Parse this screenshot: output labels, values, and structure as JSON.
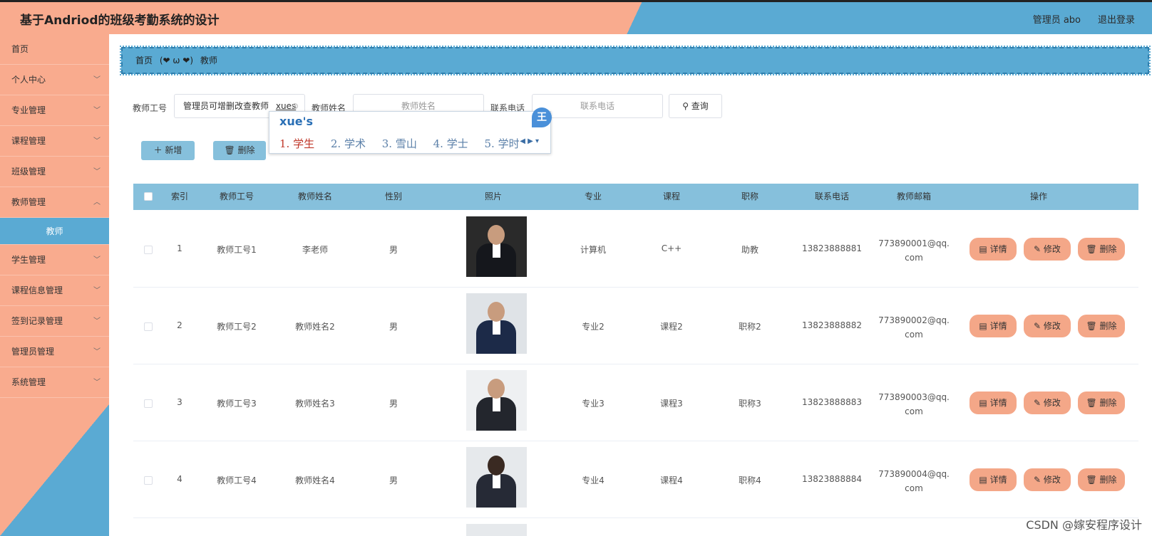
{
  "app": {
    "title": "基于Andriod的班级考勤系统的设计",
    "user": "管理员 abo",
    "logout": "退出登录"
  },
  "sidebar": {
    "items": [
      {
        "label": "首页",
        "arrow": false
      },
      {
        "label": "个人中心",
        "arrow": true
      },
      {
        "label": "专业管理",
        "arrow": true
      },
      {
        "label": "课程管理",
        "arrow": true
      },
      {
        "label": "班级管理",
        "arrow": true
      },
      {
        "label": "教师管理",
        "arrow": true
      },
      {
        "label": "教师",
        "arrow": false,
        "sub": true
      },
      {
        "label": "学生管理",
        "arrow": true
      },
      {
        "label": "课程信息管理",
        "arrow": true
      },
      {
        "label": "签到记录管理",
        "arrow": true
      },
      {
        "label": "管理员管理",
        "arrow": true
      },
      {
        "label": "系统管理",
        "arrow": true
      }
    ]
  },
  "breadcrumb": {
    "home": "首页",
    "sep": "(❤ ω ❤)",
    "current": "教师"
  },
  "search": {
    "id_label": "教师工号",
    "id_value": "管理员可增删改查教师",
    "id_ime": "xues",
    "name_label": "教师姓名",
    "name_placeholder": "教师姓名",
    "phone_label": "联系电话",
    "phone_placeholder": "联系电话",
    "query": "查询"
  },
  "ime": {
    "composition": "xue's",
    "candidates": [
      "1. 学生",
      "2. 学术",
      "3. 雪山",
      "4. 学士",
      "5. 学时"
    ],
    "badge": "王"
  },
  "actions": {
    "add": "新增",
    "delete": "删除"
  },
  "table": {
    "headers": [
      "索引",
      "教师工号",
      "教师姓名",
      "性别",
      "照片",
      "专业",
      "课程",
      "职称",
      "联系电话",
      "教师邮箱",
      "操作"
    ],
    "rows": [
      {
        "index": "1",
        "id": "教师工号1",
        "name": "李老师",
        "gender": "男",
        "major": "计算机",
        "course": "C++",
        "title": "助教",
        "phone": "13823888881",
        "email": "773890001@qq.com",
        "email_l1": "773890001@qq.",
        "email_l2": "com"
      },
      {
        "index": "2",
        "id": "教师工号2",
        "name": "教师姓名2",
        "gender": "男",
        "major": "专业2",
        "course": "课程2",
        "title": "职称2",
        "phone": "13823888882",
        "email": "773890002@qq.com",
        "email_l1": "773890002@qq.",
        "email_l2": "com"
      },
      {
        "index": "3",
        "id": "教师工号3",
        "name": "教师姓名3",
        "gender": "男",
        "major": "专业3",
        "course": "课程3",
        "title": "职称3",
        "phone": "13823888883",
        "email": "773890003@qq.com",
        "email_l1": "773890003@qq.",
        "email_l2": "com"
      },
      {
        "index": "4",
        "id": "教师工号4",
        "name": "教师姓名4",
        "gender": "男",
        "major": "专业4",
        "course": "课程4",
        "title": "职称4",
        "phone": "13823888884",
        "email": "773890004@qq.com",
        "email_l1": "773890004@qq.",
        "email_l2": "com"
      }
    ],
    "ops": {
      "detail": "详情",
      "edit": "修改",
      "delete": "删除"
    }
  },
  "watermark": "CSDN @嫁安程序设计",
  "colors": {
    "accent_blue": "#5aaad3",
    "accent_salmon": "#f9ab8e",
    "table_header": "#86c0dc"
  }
}
